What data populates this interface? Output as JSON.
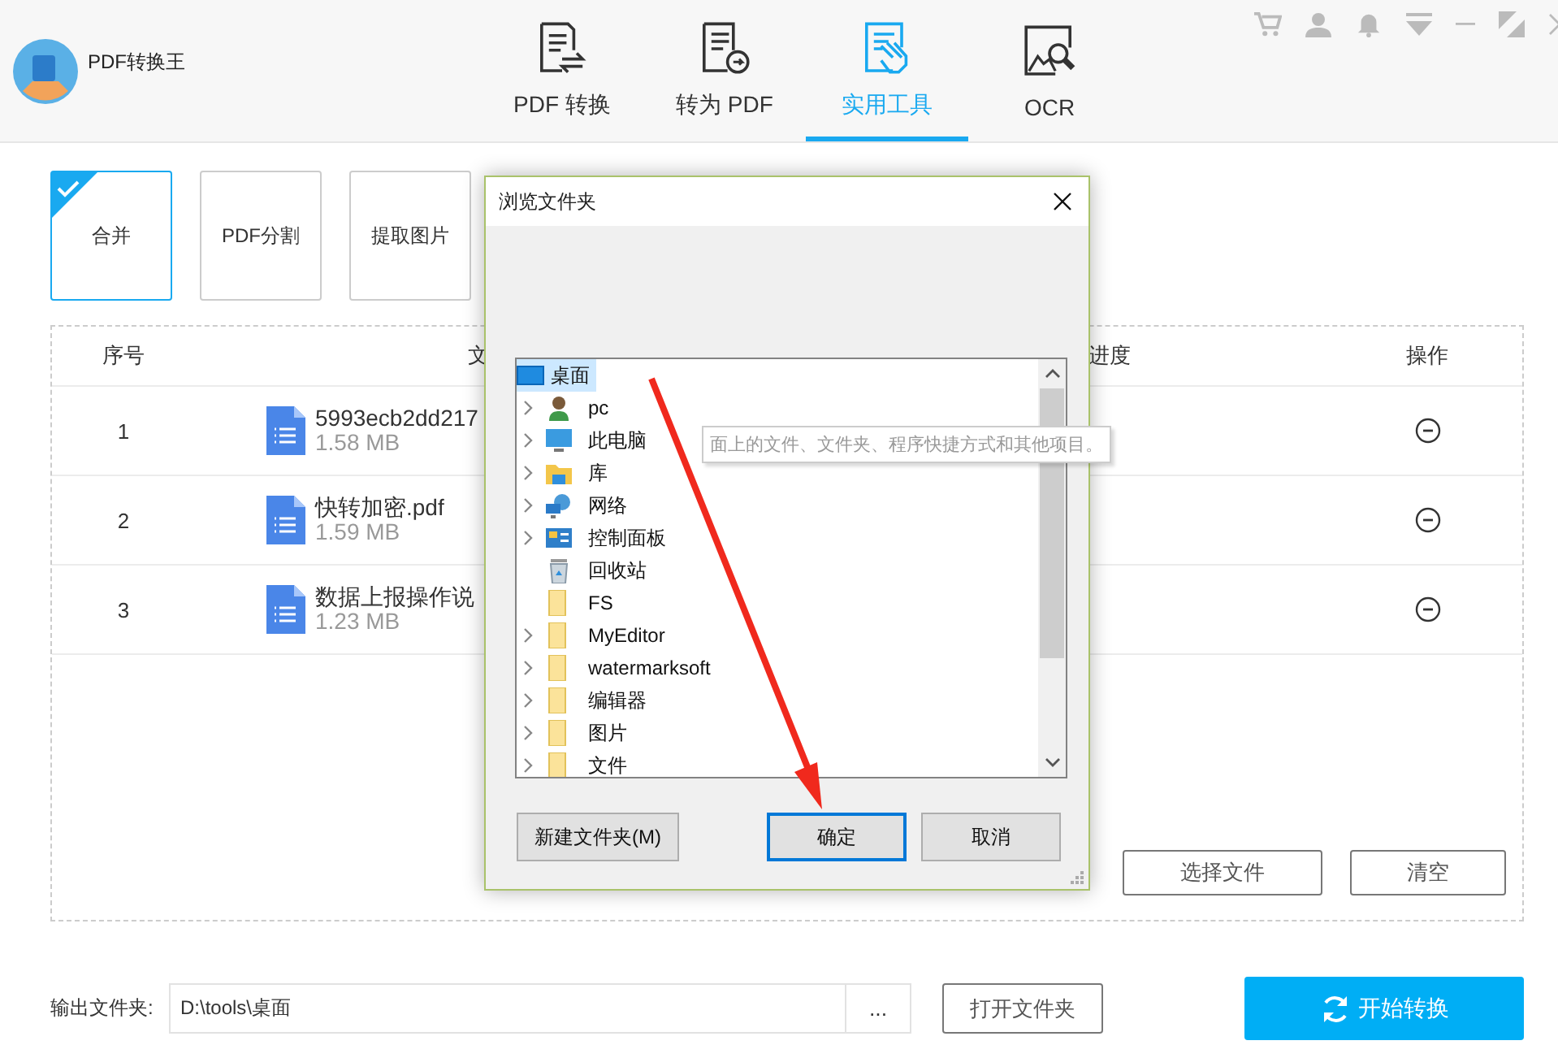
{
  "app": {
    "title": "PDF转换王"
  },
  "nav_tabs": [
    {
      "label": "PDF 转换",
      "kind": "convert",
      "selected": false
    },
    {
      "label": "转为 PDF",
      "kind": "to-pdf",
      "selected": false
    },
    {
      "label": "实用工具",
      "kind": "tools",
      "selected": true
    },
    {
      "label": "OCR",
      "kind": "ocr",
      "selected": false
    }
  ],
  "tools": [
    {
      "label": "合并",
      "selected": true
    },
    {
      "label": "PDF分割",
      "selected": false
    },
    {
      "label": "提取图片",
      "selected": false
    }
  ],
  "table": {
    "columns": [
      "序号",
      "文",
      "进度",
      "操作"
    ],
    "rows": [
      {
        "index": "1",
        "name": "5993ecb2dd217",
        "size": "1.58 MB"
      },
      {
        "index": "2",
        "name": "快转加密.pdf",
        "size": "1.59 MB"
      },
      {
        "index": "3",
        "name": "数据上报操作说",
        "size": "1.23 MB"
      }
    ]
  },
  "list_buttons": [
    "选择文件",
    "清空"
  ],
  "output": {
    "label": "输出文件夹:",
    "value": "D:\\tools\\桌面",
    "browse": "...",
    "open_button": "打开文件夹",
    "start_button": "开始转换"
  },
  "dialog": {
    "title": "浏览文件夹",
    "tree": {
      "label": "桌面",
      "kind": "desktop",
      "selected": true,
      "children": [
        {
          "label": "pc",
          "kind": "user",
          "expandable": true,
          "selected": false
        },
        {
          "label": "此电脑",
          "kind": "computer",
          "expandable": true,
          "selected": false
        },
        {
          "label": "库",
          "kind": "library",
          "expandable": true,
          "selected": false
        },
        {
          "label": "网络",
          "kind": "network",
          "expandable": true,
          "selected": false
        },
        {
          "label": "控制面板",
          "kind": "control-panel",
          "expandable": true,
          "selected": false
        },
        {
          "label": "回收站",
          "kind": "recycle",
          "expandable": false,
          "selected": false
        },
        {
          "label": "FS",
          "kind": "folder",
          "expandable": false,
          "selected": false
        },
        {
          "label": "MyEditor",
          "kind": "folder",
          "expandable": true,
          "selected": false
        },
        {
          "label": "watermarksoft",
          "kind": "folder",
          "expandable": true,
          "selected": false
        },
        {
          "label": "编辑器",
          "kind": "folder",
          "expandable": true,
          "selected": false
        },
        {
          "label": "图片",
          "kind": "folder",
          "expandable": true,
          "selected": false
        },
        {
          "label": "文件",
          "kind": "folder",
          "expandable": true,
          "selected": false
        }
      ]
    },
    "tooltip": "面上的文件、文件夹、程序快捷方式和其他项目。",
    "buttons": [
      {
        "label": "新建文件夹(M)",
        "default": false
      },
      {
        "label": "确定",
        "default": true
      },
      {
        "label": "取消",
        "default": false
      }
    ]
  }
}
